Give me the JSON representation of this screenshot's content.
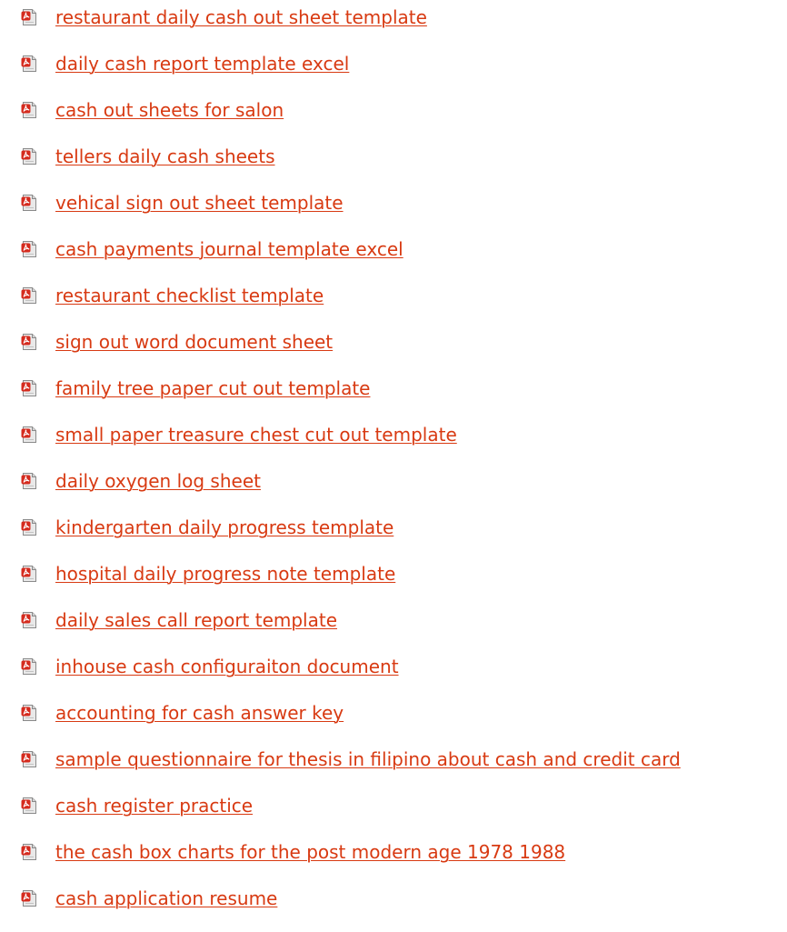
{
  "icon": "pdf-file-icon",
  "link_color": "#d83a12",
  "icon_colors": {
    "badge": "#d52b1e",
    "paper": "#e9e9e9",
    "border": "#8a8a8a"
  },
  "links": [
    "restaurant daily cash out sheet template",
    "daily cash report template excel",
    "cash out sheets for salon",
    "tellers daily cash sheets",
    "vehical sign out sheet template",
    "cash payments journal template excel",
    "restaurant checklist template",
    "sign out word document sheet",
    "family tree paper cut out template",
    "small paper treasure chest cut out template",
    "daily oxygen log sheet",
    "kindergarten daily progress template",
    "hospital daily progress note template",
    "daily sales call report template",
    "inhouse cash configuraiton document",
    "accounting for cash answer key",
    "sample questionnaire for thesis in filipino about cash and credit card",
    "cash register practice",
    "the cash box charts for the post modern age 1978 1988",
    "cash application resume"
  ]
}
